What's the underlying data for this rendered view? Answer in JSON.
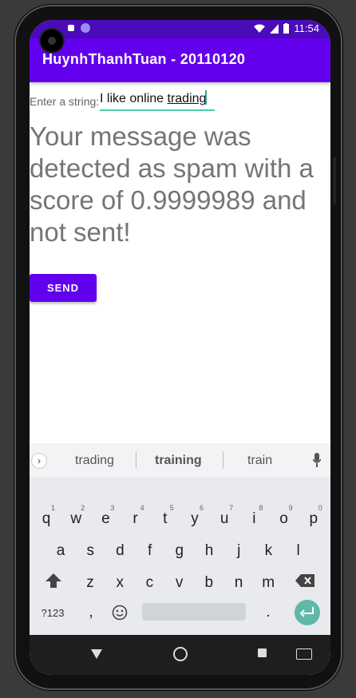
{
  "status_bar": {
    "time": "11:54"
  },
  "app_bar": {
    "title": "HuynhThanhTuan - 20110120"
  },
  "form": {
    "label": "Enter a string:",
    "input_plain": "I like online ",
    "input_underlined": "trading",
    "result": "Your message was detected as spam with a score of 0.9999989 and not sent!",
    "send_label": "SEND"
  },
  "keyboard": {
    "suggestions": [
      "trading",
      "training",
      "train"
    ],
    "row1": [
      {
        "k": "q",
        "n": "1"
      },
      {
        "k": "w",
        "n": "2"
      },
      {
        "k": "e",
        "n": "3"
      },
      {
        "k": "r",
        "n": "4"
      },
      {
        "k": "t",
        "n": "5"
      },
      {
        "k": "y",
        "n": "6"
      },
      {
        "k": "u",
        "n": "7"
      },
      {
        "k": "i",
        "n": "8"
      },
      {
        "k": "o",
        "n": "9"
      },
      {
        "k": "p",
        "n": "0"
      }
    ],
    "row2": [
      "a",
      "s",
      "d",
      "f",
      "g",
      "h",
      "j",
      "k",
      "l"
    ],
    "row3": [
      "z",
      "x",
      "c",
      "v",
      "b",
      "n",
      "m"
    ],
    "symbols_label": "?123",
    "comma": ",",
    "period": "."
  },
  "icons": {
    "mic": "mic-icon",
    "shift": "shift-icon",
    "backspace": "backspace-icon",
    "emoji": "emoji-icon",
    "enter": "enter-icon",
    "wifi": "wifi-icon",
    "signal": "signal-icon",
    "battery": "battery-icon"
  },
  "colors": {
    "primary": "#6200ee",
    "status_bar": "#4a0bb8",
    "accent": "#4ec9b0"
  }
}
